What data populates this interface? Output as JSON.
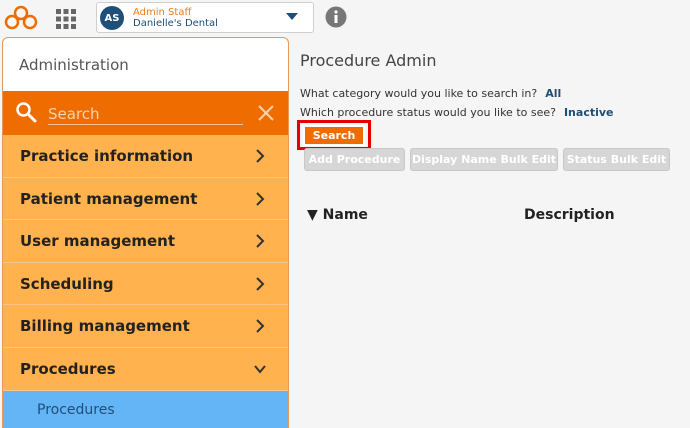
{
  "header": {
    "avatar_initials": "AS",
    "user_role": "Admin Staff",
    "practice_name": "Danielle's Dental",
    "icons": {
      "logo": "cloud-logo",
      "apps": "grid-icon",
      "dropdown": "caret-down-icon",
      "info": "info-icon"
    }
  },
  "sidebar": {
    "title": "Administration",
    "search_placeholder": "Search",
    "items": [
      {
        "label": "Practice information",
        "expanded": false
      },
      {
        "label": "Patient management",
        "expanded": false
      },
      {
        "label": "User management",
        "expanded": false
      },
      {
        "label": "Scheduling",
        "expanded": false
      },
      {
        "label": "Billing management",
        "expanded": false
      },
      {
        "label": "Procedures",
        "expanded": true
      }
    ],
    "subitem": "Procedures"
  },
  "main": {
    "title": "Procedure Admin",
    "category_question": "What category would you like to search in?",
    "category_value": "All",
    "status_question": "Which procedure status would you like to see?",
    "status_value": "Inactive",
    "search_button": "Search",
    "buttons": {
      "add": "Add Procedure",
      "bulk_name": "Display Name Bulk Edit",
      "bulk_status": "Status Bulk Edit"
    },
    "columns": {
      "name": "Name",
      "description": "Description",
      "sort_indicator": "▼"
    }
  },
  "colors": {
    "orange": "#ef6c00",
    "menu_bg": "#ffb24d",
    "navy": "#1f4e79",
    "highlight": "#e50000",
    "submenu_bg": "#64b5f6"
  }
}
